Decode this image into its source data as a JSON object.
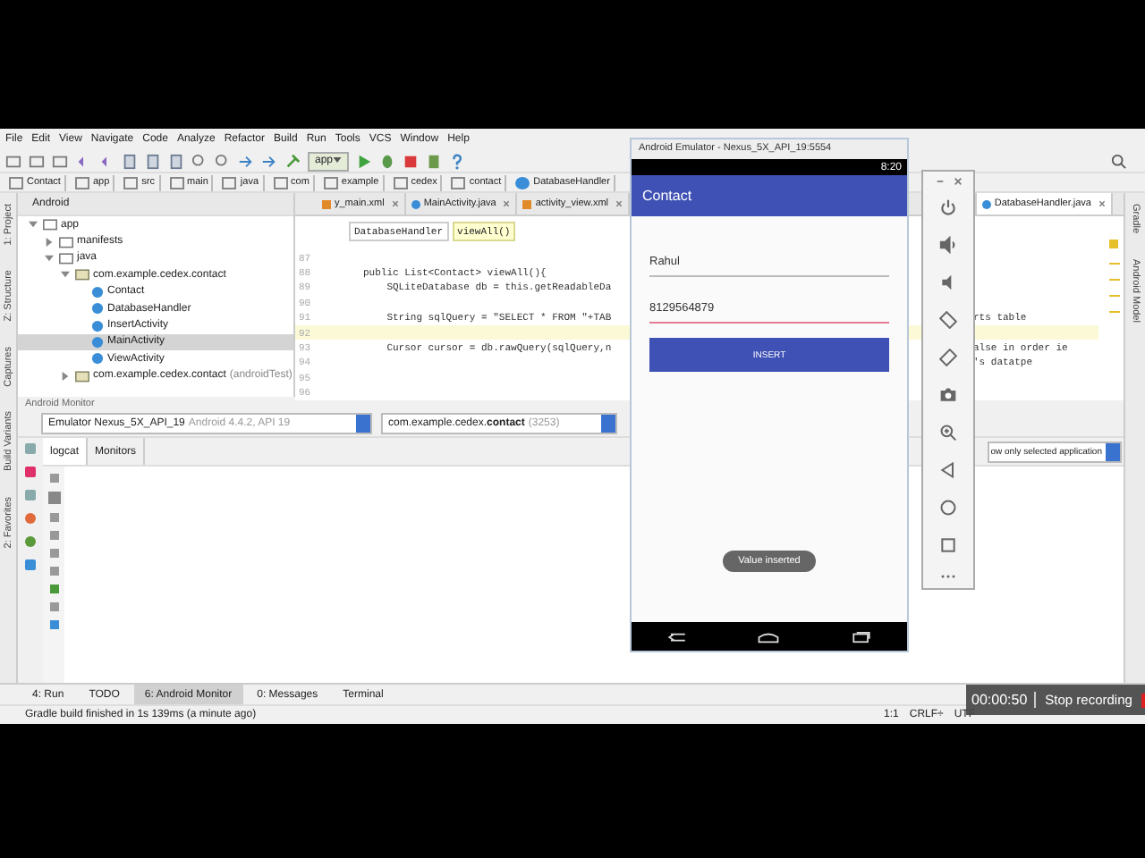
{
  "menu": [
    "File",
    "Edit",
    "View",
    "Navigate",
    "Code",
    "Analyze",
    "Refactor",
    "Build",
    "Run",
    "Tools",
    "VCS",
    "Window",
    "Help"
  ],
  "toolbar": {
    "run_config": "app"
  },
  "breadcrumbs": [
    {
      "label": "Contact",
      "kind": "folder"
    },
    {
      "label": "app",
      "kind": "folder"
    },
    {
      "label": "src",
      "kind": "folder"
    },
    {
      "label": "main",
      "kind": "folder"
    },
    {
      "label": "java",
      "kind": "folder"
    },
    {
      "label": "com",
      "kind": "folder"
    },
    {
      "label": "example",
      "kind": "folder"
    },
    {
      "label": "cedex",
      "kind": "folder"
    },
    {
      "label": "contact",
      "kind": "folder"
    },
    {
      "label": "DatabaseHandler",
      "kind": "class"
    }
  ],
  "left_tool_tabs": [
    "1: Project",
    "Z: Structure",
    "Captures",
    "Build Variants",
    "2: Favorites"
  ],
  "right_tool_tabs": [
    "Gradle",
    "Android Model"
  ],
  "project_panel": {
    "view": "Android",
    "tree": [
      {
        "label": "app",
        "kind": "folder",
        "expanded": true,
        "selected": false,
        "children": [
          {
            "label": "manifests",
            "kind": "folder",
            "expanded": false,
            "selected": false
          },
          {
            "label": "java",
            "kind": "folder",
            "expanded": true,
            "selected": false,
            "children": [
              {
                "label": "com.example.cedex.contact",
                "kind": "package",
                "expanded": true,
                "selected": false,
                "children": [
                  {
                    "label": "Contact",
                    "kind": "class",
                    "selected": false
                  },
                  {
                    "label": "DatabaseHandler",
                    "kind": "class",
                    "selected": false
                  },
                  {
                    "label": "InsertActivity",
                    "kind": "class",
                    "selected": false
                  },
                  {
                    "label": "MainActivity",
                    "kind": "class",
                    "selected": true
                  },
                  {
                    "label": "ViewActivity",
                    "kind": "class",
                    "selected": false
                  }
                ]
              },
              {
                "label": "com.example.cedex.contact",
                "note": "(androidTest)",
                "kind": "package",
                "expanded": false,
                "selected": false
              }
            ]
          }
        ]
      }
    ]
  },
  "editor": {
    "tabs": [
      {
        "label": "y_main.xml",
        "kind": "xml",
        "selected": false
      },
      {
        "label": "MainActivity.java",
        "kind": "class",
        "selected": false
      },
      {
        "label": "activity_view.xml",
        "kind": "xml",
        "selected": false
      }
    ],
    "active_tab": {
      "label": "DatabaseHandler.java",
      "kind": "class"
    },
    "crumbs": [
      {
        "label": "DatabaseHandler",
        "selected": false
      },
      {
        "label": "viewAll()",
        "selected": true
      }
    ],
    "lines": [
      {
        "number": "87",
        "current": false
      },
      {
        "number": "88",
        "code": "public List<Contact> viewAll(){",
        "current": false
      },
      {
        "number": "89",
        "code": "    SQLiteDatabase db = this.getReadableDa",
        "current": false
      },
      {
        "number": "90",
        "current": false
      },
      {
        "number": "91",
        "code": "    String sqlQuery = \"SELECT * FROM \"+TAB",
        "tail": "rts table",
        "current": false
      },
      {
        "number": "92",
        "current": true
      },
      {
        "number": "93",
        "code": "    Cursor cursor = db.rawQuery(sqlQuery,n",
        "tail": "alse in order ie",
        "current": false
      },
      {
        "number": "94",
        "tail": "'s datatpe",
        "current": false
      },
      {
        "number": "95",
        "current": false
      },
      {
        "number": "96",
        "current": false
      }
    ]
  },
  "monitor": {
    "title": "Android Monitor",
    "device": {
      "name": "Emulator Nexus_5X_API_19",
      "detail": "Android 4.4.2, API 19"
    },
    "process": {
      "name": "com.example.cedex.**contact**",
      "pid": "(3253)"
    },
    "tabs": [
      {
        "label": "logcat",
        "selected": true
      },
      {
        "label": "Monitors",
        "selected": false
      }
    ],
    "filter": "ow only selected application"
  },
  "bottom_tabs": [
    {
      "label": "4: Run",
      "selected": false
    },
    {
      "label": "TODO",
      "selected": false
    },
    {
      "label": "6: Android Monitor",
      "selected": true
    },
    {
      "label": "0: Messages",
      "selected": false
    },
    {
      "label": "Terminal",
      "selected": false
    }
  ],
  "status": {
    "message": "Gradle build finished in 1s 139ms (a minute ago)",
    "position": "1:1",
    "line_separator": "CRLF÷",
    "encoding": "UTF"
  },
  "emulator": {
    "title": "Android Emulator - Nexus_5X_API_19:5554",
    "time": "8:20",
    "app_title": "Contact",
    "fields": [
      {
        "value": "Rahul",
        "focused": false
      },
      {
        "value": "8129564879",
        "focused": true
      }
    ],
    "button": "INSERT",
    "toast": "Value inserted"
  },
  "recording": {
    "elapsed": "00:00:50",
    "action": "Stop recording"
  }
}
